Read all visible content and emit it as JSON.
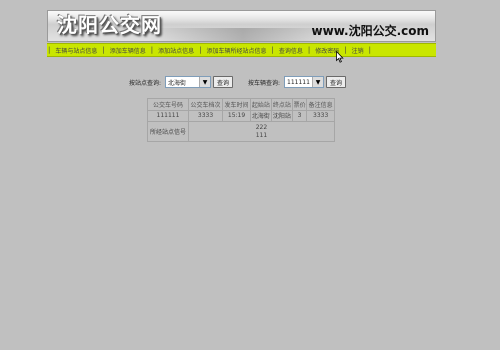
{
  "banner": {
    "logo_text": "沈阳公交网",
    "url_text": "www.沈阳公交.com"
  },
  "nav": {
    "items": [
      "车辆与站点信息",
      "添加车辆信息",
      "添加站点信息",
      "添加车辆所经站点信息",
      "查询信息",
      "修改密码",
      "注销"
    ]
  },
  "query": {
    "station_label": "按站点查询:",
    "station_value": "北海街",
    "station_button": "查询",
    "vehicle_label": "按车辆查询:",
    "vehicle_value": "111111",
    "vehicle_button": "查询"
  },
  "results": {
    "headers": [
      "公交车号码",
      "公交车档次",
      "发车时间",
      "起始站",
      "终点站",
      "票价",
      "备注信息"
    ],
    "row": [
      "111111",
      "3333",
      "15:19",
      "北海街",
      "沈阳站",
      "3",
      "3333"
    ],
    "stations_label": "所经站点信号",
    "stations": [
      "222",
      "111"
    ]
  },
  "colors": {
    "page_bg": "#c0c0c0",
    "nav_bg": "#c9e600"
  }
}
